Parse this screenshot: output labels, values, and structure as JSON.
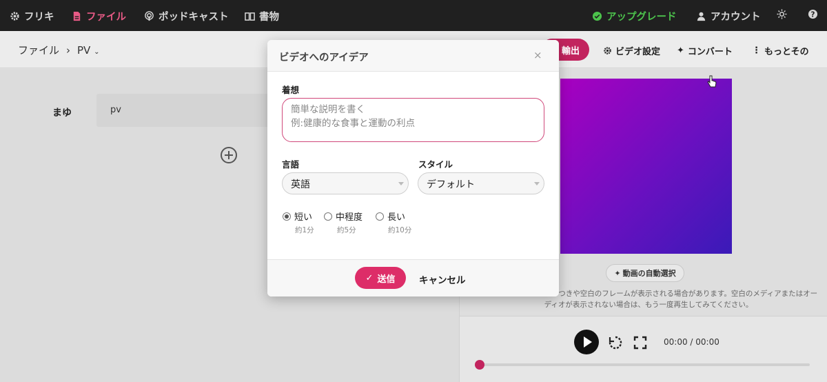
{
  "nav": {
    "items": [
      {
        "label": "フリキ",
        "icon": "gear-icon"
      },
      {
        "label": "ファイル",
        "icon": "file-icon",
        "active": true
      },
      {
        "label": "ポッドキャスト",
        "icon": "podcast-icon"
      },
      {
        "label": "書物",
        "icon": "book-icon"
      }
    ],
    "upgrade_label": "アップグレード",
    "account_label": "アカウント"
  },
  "breadcrumb": {
    "root": "ファイル",
    "separator": "›",
    "current": "PV"
  },
  "toolbar": {
    "export_label": "輸出",
    "video_settings_label": "ビデオ設定",
    "convert_label": "コンバート",
    "more_label": "もっとその"
  },
  "script": {
    "speaker": "まゆ",
    "text": "pv"
  },
  "preview": {
    "auto_select_label": "動画の自動選択",
    "notice_text": "…レビューであり、ちらつきや空白のフレームが表示される場合があります。空白のメディアまたはオーディオが表示されない場合は、もう一度再生してみてください。",
    "time": "00:00 / 00:00",
    "progress": 0
  },
  "modal": {
    "title": "ビデオへのアイデア",
    "close_symbol": "×",
    "idea_label": "着想",
    "idea_placeholder_1": "簡単な説明を書く",
    "idea_placeholder_2": "例:健康的な食事と運動の利点",
    "language_label": "言語",
    "language_value": "英語",
    "style_label": "スタイル",
    "style_value": "デフォルト",
    "lengths": [
      {
        "label": "短い",
        "sub": "約1分",
        "selected": true
      },
      {
        "label": "中程度",
        "sub": "約5分",
        "selected": false
      },
      {
        "label": "長い",
        "sub": "約10分",
        "selected": false
      }
    ],
    "send_label": "送信",
    "cancel_label": "キャンセル"
  },
  "colors": {
    "accent": "#dd2d68",
    "upgrade": "#4cc34c",
    "nav_bg": "#202020"
  }
}
